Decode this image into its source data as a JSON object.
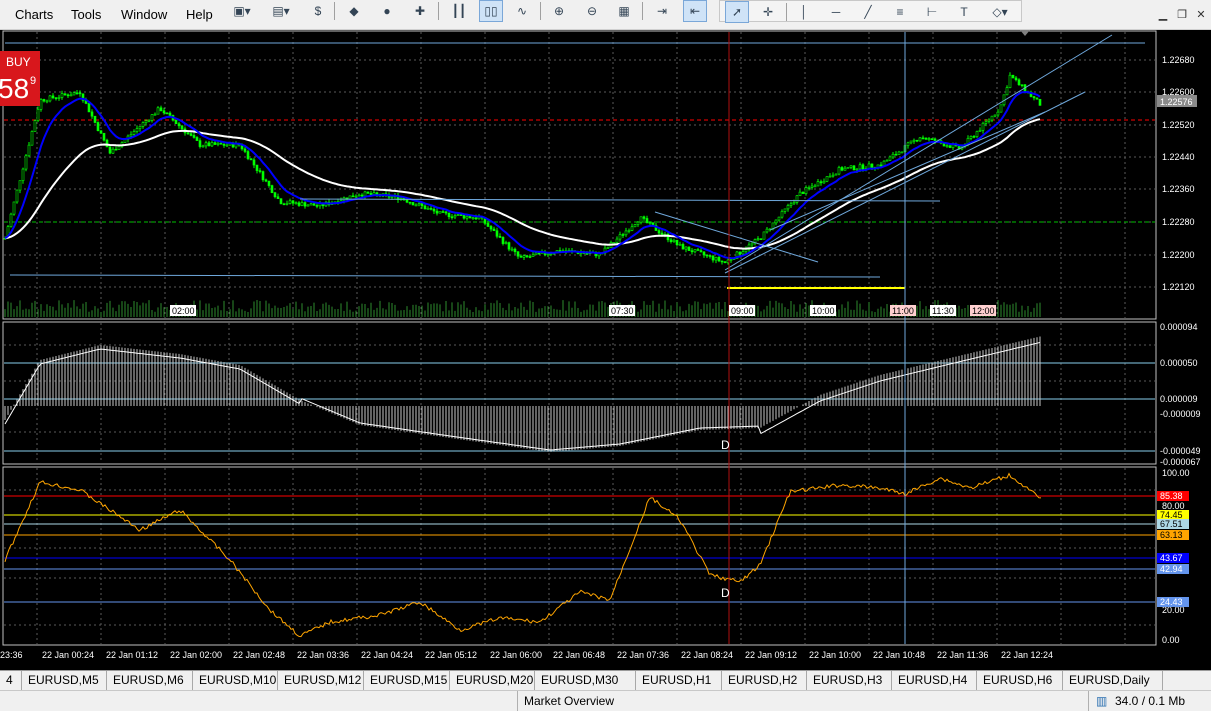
{
  "menu": [
    "Charts",
    "Tools",
    "Window",
    "Help"
  ],
  "buy": {
    "label": "BUY",
    "price": "58",
    "pip": "9"
  },
  "main_axis": {
    "ticks": [
      "1.22680",
      "1.22600",
      "1.22520",
      "1.22440",
      "1.22360",
      "1.22280",
      "1.22200",
      "1.22120"
    ],
    "current": "1.22576"
  },
  "macd_axis": {
    "ticks": [
      "0.000094",
      "0.000050",
      "0.000009",
      "-0.000009",
      "-0.000049",
      "-0.000067"
    ]
  },
  "stoch_axis": {
    "ticks": [
      "100.00",
      "80.00",
      "20.00",
      "0.00"
    ],
    "levels": [
      "85.38",
      "74.45",
      "67.51",
      "63.13",
      "43.67",
      "42.94",
      "24.43"
    ]
  },
  "time_labels": [
    "02:00",
    "07:30",
    "09:00",
    "10:00",
    "11:00",
    "11:30",
    "12:00"
  ],
  "x_axis": [
    "23:36",
    "22 Jan 00:24",
    "22 Jan 01:12",
    "22 Jan 02:00",
    "22 Jan 02:48",
    "22 Jan 03:36",
    "22 Jan 04:24",
    "22 Jan 05:12",
    "22 Jan 06:00",
    "22 Jan 06:48",
    "22 Jan 07:36",
    "22 Jan 08:24",
    "22 Jan 09:12",
    "22 Jan 10:00",
    "22 Jan 10:48",
    "22 Jan 11:36",
    "22 Jan 12:24"
  ],
  "markers": [
    "D",
    "D"
  ],
  "tabs": [
    "4",
    "EURUSD,M5",
    "EURUSD,M6",
    "EURUSD,M10",
    "EURUSD,M12",
    "EURUSD,M15",
    "EURUSD,M20",
    "EURUSD,M30",
    "EURUSD,H1",
    "EURUSD,H2",
    "EURUSD,H3",
    "EURUSD,H4",
    "EURUSD,H6",
    "EURUSD,Daily"
  ],
  "status": {
    "market_overview": "Market Overview",
    "traffic": "34.0 / 0.1 Mb"
  },
  "colors": {
    "bg": "#000000",
    "bull_candle": "#00ff00",
    "ma_fast": "#0000ff",
    "ma_slow": "#ffffff",
    "stoch": "#ffa500",
    "level_red": "#ff0000",
    "highlight_yellow": "#ffff00"
  }
}
